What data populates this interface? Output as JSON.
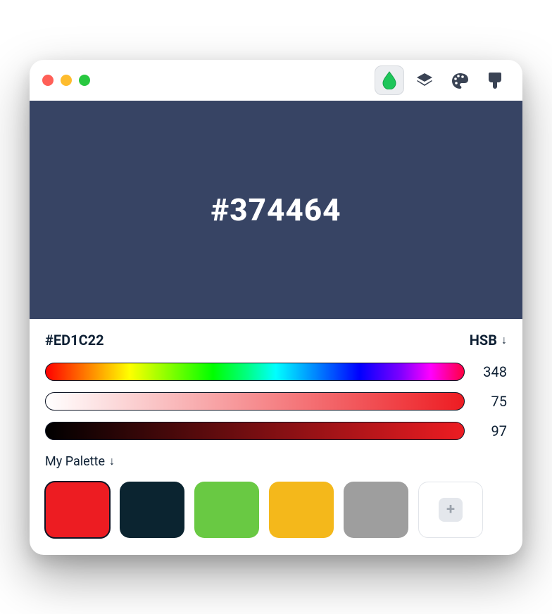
{
  "window": {
    "traffic": {
      "close": "#ff5f57",
      "min": "#febc2e",
      "max": "#28c840"
    }
  },
  "toolbar": {
    "items": [
      {
        "name": "drop-icon",
        "active": true
      },
      {
        "name": "layers-icon",
        "active": false
      },
      {
        "name": "palette-icon",
        "active": false
      },
      {
        "name": "brush-icon",
        "active": false
      }
    ]
  },
  "preview": {
    "bg": "#374464",
    "hex_label": "#374464",
    "fg": "#ffffff"
  },
  "picker": {
    "hex": "#ED1C22",
    "mode_label": "HSB",
    "hue": {
      "value": 348
    },
    "sat": {
      "value": 75
    },
    "bri": {
      "value": 97
    }
  },
  "palette": {
    "label": "My Palette",
    "swatches": [
      {
        "color": "#ED1C22",
        "selected": true
      },
      {
        "color": "#0B2430",
        "selected": false
      },
      {
        "color": "#69C943",
        "selected": false
      },
      {
        "color": "#F4B81B",
        "selected": false
      },
      {
        "color": "#9E9E9E",
        "selected": false
      }
    ]
  }
}
